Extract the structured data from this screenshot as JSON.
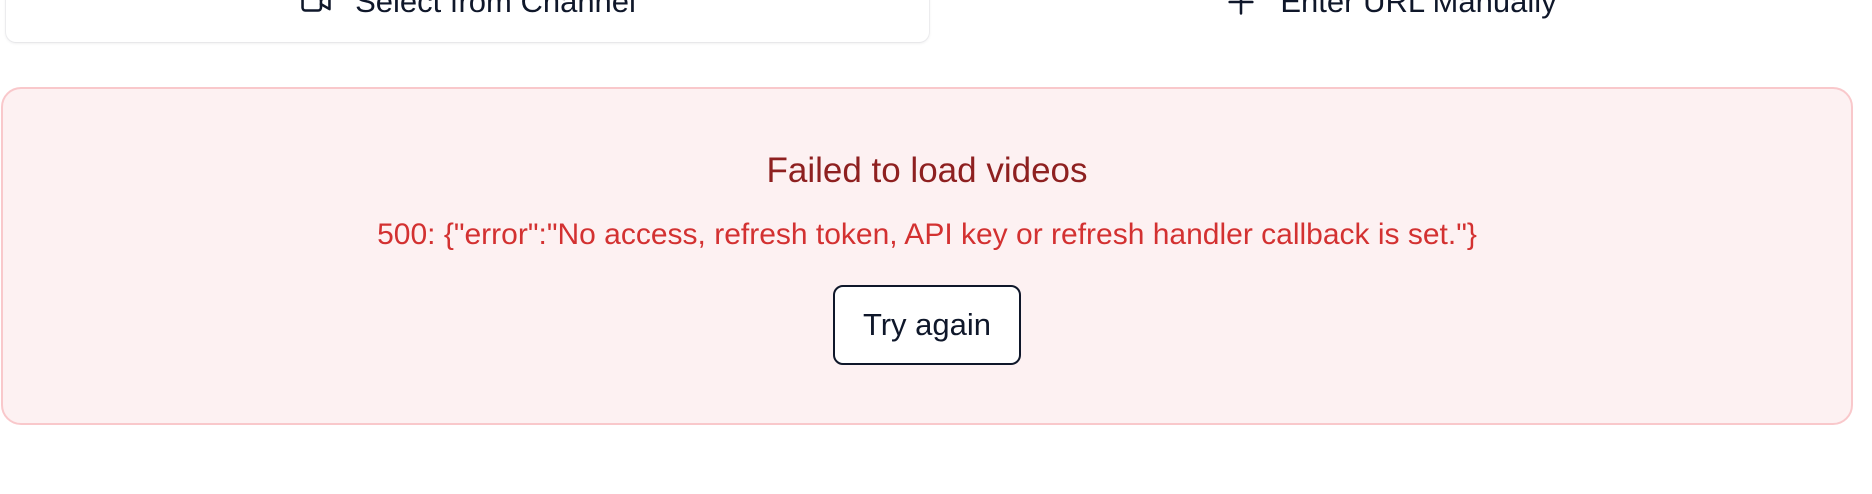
{
  "source_tabs": [
    {
      "label": "Select from Channel",
      "icon": "video-camera-icon",
      "active": true
    },
    {
      "label": "Enter URL Manually",
      "icon": "plus-icon",
      "active": false
    }
  ],
  "error": {
    "title": "Failed to load videos",
    "message": "500: {\"error\":\"No access, refresh token, API key or refresh handler callback is set.\"}",
    "retry_label": "Try again"
  },
  "colors": {
    "error_background": "#fdf1f2",
    "error_border": "#f9c8cb",
    "error_title": "#8e2020",
    "error_message": "#d33131",
    "text": "#0f172a"
  }
}
